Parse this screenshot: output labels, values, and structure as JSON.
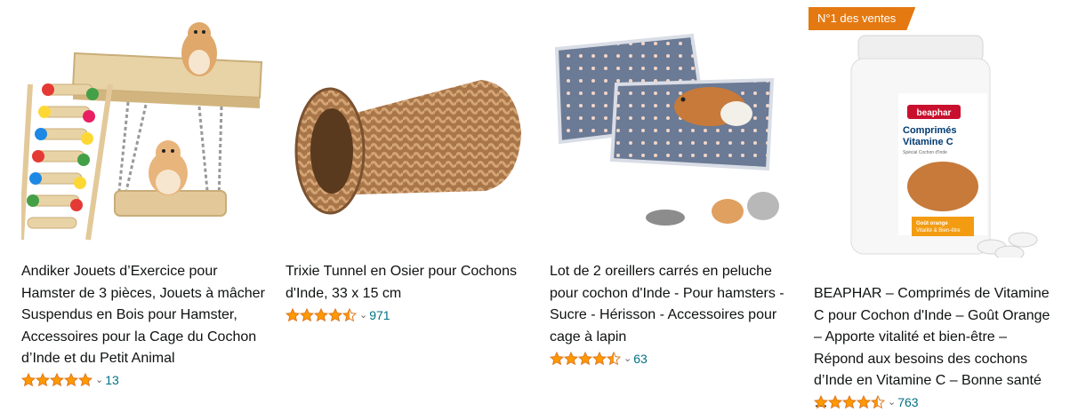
{
  "colors": {
    "star": "#ff9900",
    "link": "#007185",
    "badge": "#e47911",
    "text": "#0f1111"
  },
  "products": [
    {
      "title": "Andiker Jouets d’Exercice pour Hamster de 3 pièces, Jouets à mâcher Suspendus en Bois pour Hamster, Accessoires pour la Cage du Cochon d’Inde et du Petit Animal",
      "rating": 5,
      "rating_count": "13",
      "image_icon": "hamster-swing-ladder-toy"
    },
    {
      "title": "Trixie Tunnel en Osier pour Cochons d'Inde, 33 x 15 cm",
      "rating": 4.5,
      "rating_count": "971",
      "image_icon": "wicker-tunnel"
    },
    {
      "title": "Lot de 2 oreillers carrés en peluche pour cochon d'Inde - Pour hamsters - Sucre - Hérisson - Accessoires pour cage à lapin",
      "rating": 4.5,
      "rating_count": "63",
      "image_icon": "plush-pillows"
    },
    {
      "badge": "N°1 des ventes",
      "title": "BEAPHAR – Comprimés de Vitamine C pour Cochon d'Inde – Goût Orange – Apporte vitalité et bien-être – Répond aux besoins des cochons d’Inde en Vitamine C – Bonne santé …",
      "rating": 4.5,
      "rating_count": "763",
      "image_icon": "vitamin-bottle",
      "label": {
        "brand": "beaphar",
        "line1": "Comprimés",
        "line2": "Vitamine C",
        "sub": "Spécial Cochon d'Inde",
        "flavor1": "Goût orange",
        "flavor2": "Vitalité & Bien-être"
      }
    }
  ]
}
